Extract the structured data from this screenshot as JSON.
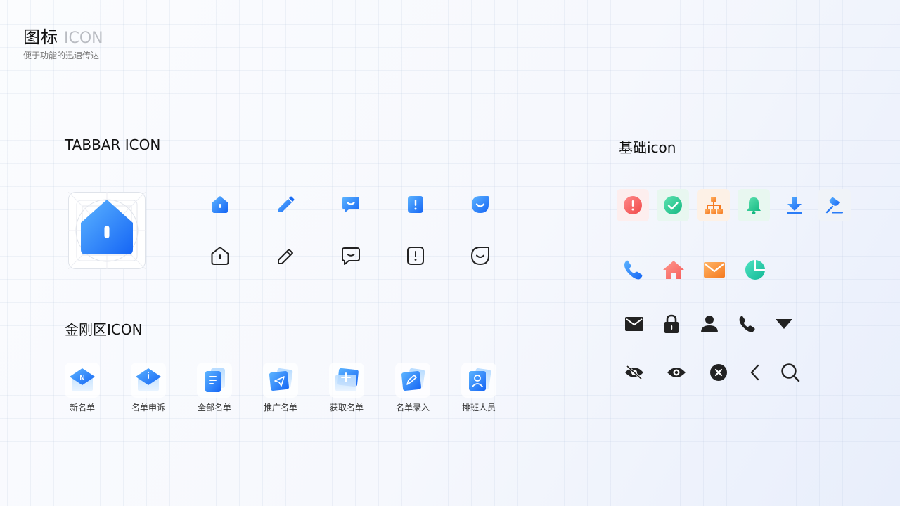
{
  "header": {
    "title": "图标",
    "title_en": "ICON",
    "subtitle": "便于功能的迅速传达"
  },
  "tabbar_section": {
    "title": "TABBAR ICON",
    "icons": [
      "home-icon",
      "pencil-icon",
      "message-icon",
      "alert-icon",
      "smile-icon"
    ]
  },
  "kingkong_section": {
    "title": "金刚区ICON",
    "items": [
      {
        "label": "新名单",
        "icon": "new-list-icon"
      },
      {
        "label": "名单申诉",
        "icon": "appeal-icon"
      },
      {
        "label": "全部名单",
        "icon": "all-lists-icon"
      },
      {
        "label": "推广名单",
        "icon": "promote-icon"
      },
      {
        "label": "获取名单",
        "icon": "acquire-icon"
      },
      {
        "label": "名单录入",
        "icon": "entry-icon"
      },
      {
        "label": "排班人员",
        "icon": "staff-icon"
      }
    ]
  },
  "basic_section": {
    "title": "基础icon",
    "row1": [
      "error-icon",
      "check-icon",
      "org-chart-icon",
      "bell-icon",
      "download-icon",
      "pin-icon"
    ],
    "row2": [
      "phone-icon",
      "home-icon",
      "mail-icon",
      "pie-chart-icon"
    ],
    "row3": [
      "mail-icon",
      "lock-icon",
      "user-icon",
      "phone-icon",
      "triangle-down-icon"
    ],
    "row4": [
      "eye-off-icon",
      "eye-icon",
      "close-circle-icon",
      "chevron-left-icon",
      "search-icon"
    ]
  },
  "colors": {
    "brand_blue": "#2a7cf7",
    "dark": "#222222"
  }
}
